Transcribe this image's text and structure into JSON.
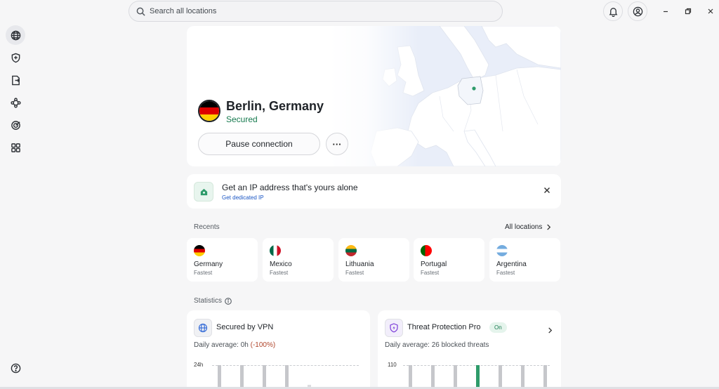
{
  "search": {
    "placeholder": "Search all locations"
  },
  "sidebar": {
    "items": [
      {
        "icon": "globe-icon",
        "active": true
      },
      {
        "icon": "shield-icon",
        "active": false
      },
      {
        "icon": "file-transfer-icon",
        "active": false
      },
      {
        "icon": "meshnet-icon",
        "active": false
      },
      {
        "icon": "target-icon",
        "active": false
      },
      {
        "icon": "apps-grid-icon",
        "active": false
      }
    ],
    "help_icon": "help-icon"
  },
  "topbar": {
    "notifications_icon": "bell-icon",
    "account_icon": "account-icon"
  },
  "connection": {
    "location": "Berlin, Germany",
    "status": "Secured",
    "pause_label": "Pause connection",
    "more_label": "···",
    "flag_colors": [
      "#000000",
      "#dd0000",
      "#ffce00"
    ]
  },
  "banner": {
    "title": "Get an IP address that's yours alone",
    "link": "Get dedicated IP"
  },
  "recents": {
    "label": "Recents",
    "all_label": "All locations",
    "items": [
      {
        "name": "Germany",
        "sub": "Fastest",
        "flag": "germany"
      },
      {
        "name": "Mexico",
        "sub": "Fastest",
        "flag": "mexico"
      },
      {
        "name": "Lithuania",
        "sub": "Fastest",
        "flag": "lithuania"
      },
      {
        "name": "Portugal",
        "sub": "Fastest",
        "flag": "portugal"
      },
      {
        "name": "Argentina",
        "sub": "Fastest",
        "flag": "argentina"
      }
    ]
  },
  "statistics": {
    "label": "Statistics",
    "vpn": {
      "title": "Secured by VPN",
      "daily_prefix": "Daily average: 0h ",
      "daily_change": "(-100%)",
      "axis_max": "24h"
    },
    "threat": {
      "title": "Threat Protection Pro",
      "badge": "On",
      "daily": "Daily average: 26 blocked threats",
      "axis_max": "110"
    }
  },
  "colors": {
    "accent_green": "#177a4f",
    "link_blue": "#1a56c4",
    "bar_gray": "#c6c7cb",
    "bar_green": "#2e9b6a"
  }
}
